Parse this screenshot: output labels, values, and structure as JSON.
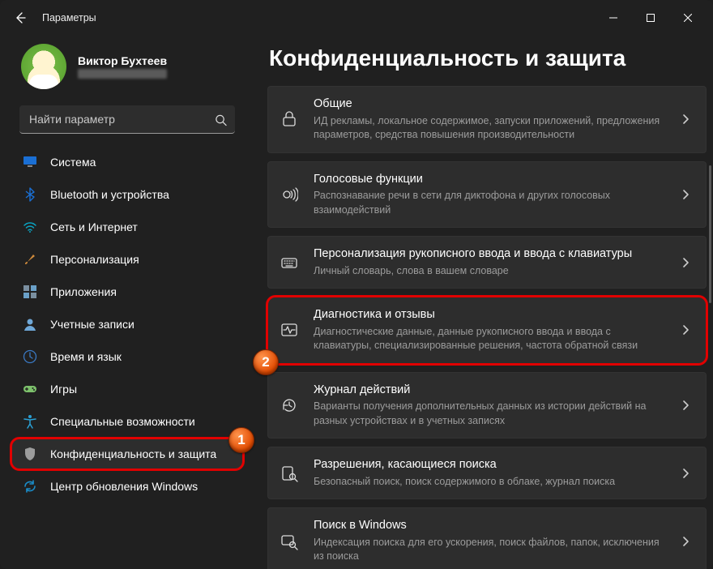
{
  "titlebar": {
    "title": "Параметры"
  },
  "account": {
    "name": "Виктор Бухтеев"
  },
  "search": {
    "placeholder": "Найти параметр"
  },
  "nav": [
    {
      "label": "Система",
      "icon": "monitor",
      "color": "#1a6fd4"
    },
    {
      "label": "Bluetooth и устройства",
      "icon": "bluetooth",
      "color": "#1a6fd4"
    },
    {
      "label": "Сеть и Интернет",
      "icon": "wifi",
      "color": "#0aa2c0"
    },
    {
      "label": "Персонализация",
      "icon": "brush",
      "color": "#d08b3c"
    },
    {
      "label": "Приложения",
      "icon": "apps",
      "color": "#7a8fa0"
    },
    {
      "label": "Учетные записи",
      "icon": "user",
      "color": "#6fa8d8"
    },
    {
      "label": "Время и язык",
      "icon": "clock-globe",
      "color": "#3a78c2"
    },
    {
      "label": "Игры",
      "icon": "gamepad",
      "color": "#7cc06b"
    },
    {
      "label": "Специальные возможности",
      "icon": "accessibility",
      "color": "#2aa0d4"
    },
    {
      "label": "Конфиденциальность и защита",
      "icon": "shield",
      "color": "#9c9c9c",
      "selected": true
    },
    {
      "label": "Центр обновления Windows",
      "icon": "update",
      "color": "#1a8cc8"
    }
  ],
  "page": {
    "title": "Конфиденциальность и защита"
  },
  "cards": [
    {
      "icon": "lock",
      "title": "Общие",
      "desc": "ИД рекламы, локальное содержимое, запуски приложений, предложения параметров, средства повышения производительности"
    },
    {
      "icon": "voice",
      "title": "Голосовые функции",
      "desc": "Распознавание речи в сети для диктофона и других голосовых взаимодействий"
    },
    {
      "icon": "keyboard",
      "title": "Персонализация рукописного ввода и ввода с клавиатуры",
      "desc": "Личный словарь, слова в вашем словаре"
    },
    {
      "icon": "pulse",
      "title": "Диагностика и отзывы",
      "desc": "Диагностические данные, данные рукописного ввода и ввода с клавиатуры, специализированные решения, частота обратной связи"
    },
    {
      "icon": "history",
      "title": "Журнал действий",
      "desc": "Варианты получения дополнительных данных из истории действий на разных устройствах и в учетных записях"
    },
    {
      "icon": "search-doc",
      "title": "Разрешения, касающиеся поиска",
      "desc": "Безопасный поиск, поиск содержимого в облаке, журнал поиска"
    },
    {
      "icon": "search-win",
      "title": "Поиск в Windows",
      "desc": "Индексация поиска для его ускорения, поиск файлов, папок, исключения из поиска"
    }
  ],
  "annotations": {
    "b1": "1",
    "b2": "2"
  }
}
